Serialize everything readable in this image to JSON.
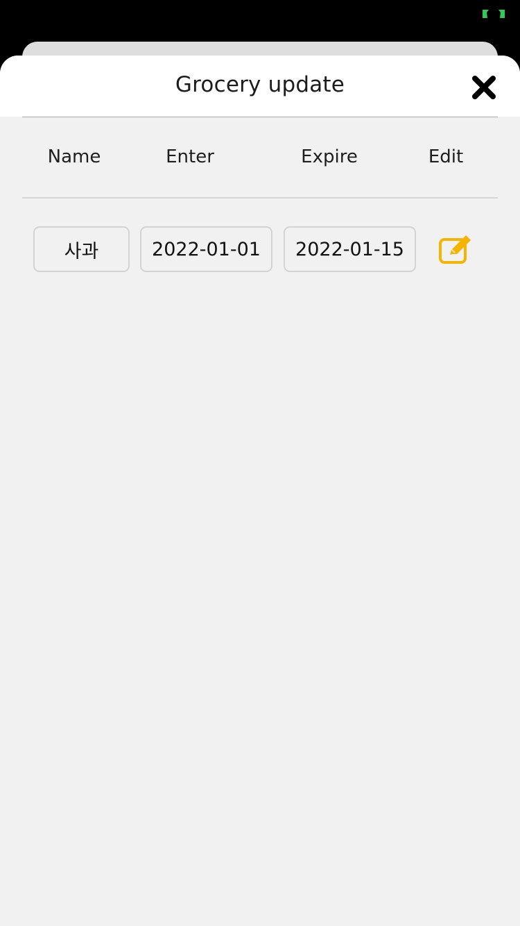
{
  "status": {
    "indicator_icon": "screen-mirroring-icon",
    "indicator_color": "#34c759"
  },
  "sheet": {
    "title": "Grocery update",
    "close_icon": "close-icon"
  },
  "table": {
    "columns": [
      "Name",
      "Enter",
      "Expire",
      "Edit"
    ],
    "rows": [
      {
        "name": "사과",
        "enter": "2022-01-01",
        "expire": "2022-01-15",
        "edit_icon": "edit-icon"
      }
    ]
  },
  "colors": {
    "accent_edit": "#f5b400",
    "sheet_background": "#f1f1f1",
    "header_background": "#ffffff",
    "backdrop": "#000000"
  }
}
